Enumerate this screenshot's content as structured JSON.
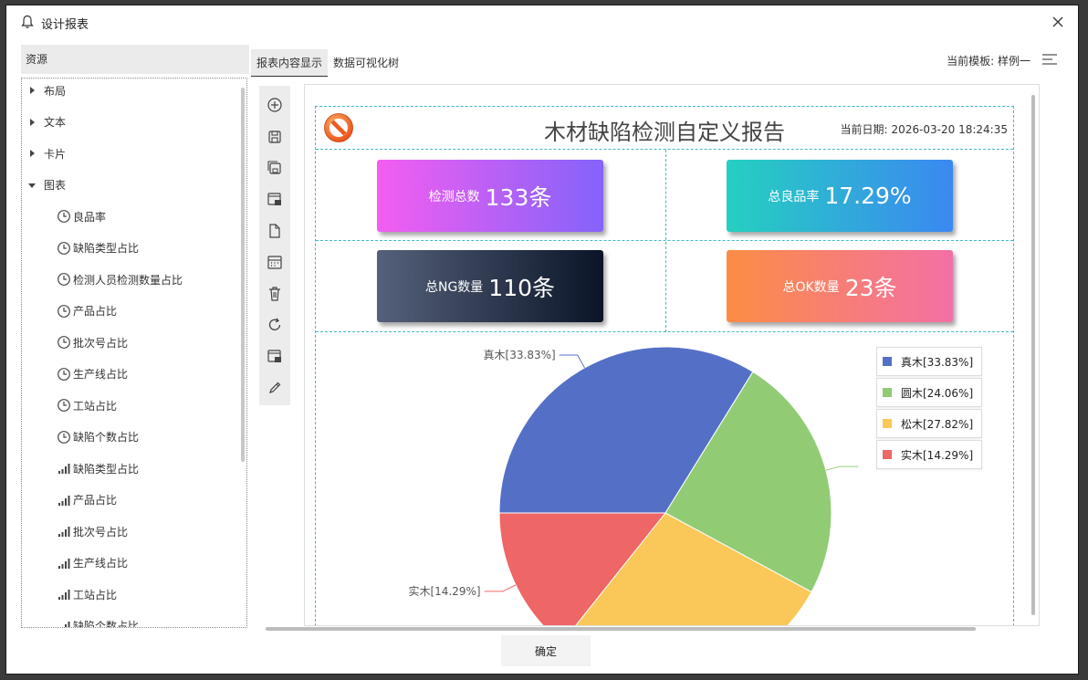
{
  "window": {
    "title": "设计报表"
  },
  "resources": {
    "header": "资源",
    "groups": [
      {
        "label": "布局",
        "expanded": false
      },
      {
        "label": "文本",
        "expanded": false
      },
      {
        "label": "卡片",
        "expanded": false
      },
      {
        "label": "图表",
        "expanded": true
      }
    ],
    "items": [
      {
        "label": "良品率",
        "icon": "clock-icon"
      },
      {
        "label": "缺陷类型占比",
        "icon": "clock-icon"
      },
      {
        "label": "检测人员检测数量占比",
        "icon": "clock-icon"
      },
      {
        "label": "产品占比",
        "icon": "clock-icon"
      },
      {
        "label": "批次号占比",
        "icon": "clock-icon"
      },
      {
        "label": "生产线占比",
        "icon": "clock-icon"
      },
      {
        "label": "工站占比",
        "icon": "clock-icon"
      },
      {
        "label": "缺陷个数占比",
        "icon": "clock-icon"
      },
      {
        "label": "缺陷类型占比",
        "icon": "bar-chart-icon"
      },
      {
        "label": "产品占比",
        "icon": "bar-chart-icon"
      },
      {
        "label": "批次号占比",
        "icon": "bar-chart-icon"
      },
      {
        "label": "生产线占比",
        "icon": "bar-chart-icon"
      },
      {
        "label": "工站占比",
        "icon": "bar-chart-icon"
      },
      {
        "label": "缺陷个数占比",
        "icon": "bar-chart-icon"
      }
    ]
  },
  "tabs": [
    {
      "label": "报表内容显示",
      "active": true
    },
    {
      "label": "数据可视化树",
      "active": false
    }
  ],
  "template": {
    "label": "当前模板: 样例一"
  },
  "toolbar": [
    "add-icon",
    "save-icon",
    "save-as-icon",
    "export-icon",
    "new-file-icon",
    "calendar-icon",
    "delete-icon",
    "refresh-icon",
    "import-icon",
    "edit-icon"
  ],
  "report": {
    "title": "木材缺陷检测自定义报告",
    "date_label": "当前日期:",
    "date_value": "2026-03-20 18:24:35",
    "cards": [
      {
        "label": "检测总数",
        "value": "133条"
      },
      {
        "label": "总良品率",
        "value": "17.29%"
      },
      {
        "label": "总NG数量",
        "value": "110条"
      },
      {
        "label": "总OK数量",
        "value": "23条"
      }
    ]
  },
  "chart_data": {
    "type": "pie",
    "categories": [
      "真木",
      "圆木",
      "松木",
      "实木"
    ],
    "values": [
      33.83,
      24.06,
      27.82,
      14.29
    ],
    "labels": [
      "真木[33.83%]",
      "圆木[24.06%]",
      "松木[27.82%]",
      "实木[14.29%]"
    ],
    "colors": [
      "#5470c6",
      "#91cc75",
      "#fac858",
      "#ee6666"
    ],
    "legend_position": "top-right"
  },
  "footer": {
    "ok_label": "确定"
  }
}
